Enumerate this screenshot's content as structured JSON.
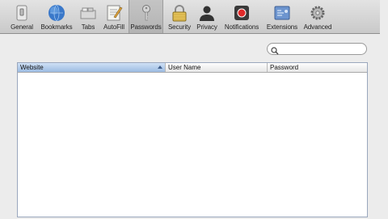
{
  "toolbar": {
    "items": [
      {
        "label": "General"
      },
      {
        "label": "Bookmarks"
      },
      {
        "label": "Tabs"
      },
      {
        "label": "AutoFill"
      },
      {
        "label": "Passwords",
        "selected": true
      },
      {
        "label": "Security"
      },
      {
        "label": "Privacy"
      },
      {
        "label": "Notifications"
      },
      {
        "label": "Extensions"
      },
      {
        "label": "Advanced"
      }
    ]
  },
  "search": {
    "placeholder": ""
  },
  "table": {
    "columns": [
      {
        "label": "Website"
      },
      {
        "label": "User Name"
      },
      {
        "label": "Password"
      }
    ],
    "rows": []
  }
}
